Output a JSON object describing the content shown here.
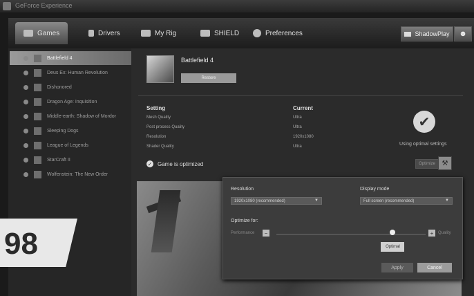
{
  "window": {
    "title": "GeForce Experience"
  },
  "nav": {
    "tabs": [
      {
        "label": "Games",
        "icon": "gamepad-icon"
      },
      {
        "label": "Drivers",
        "icon": "download-icon"
      },
      {
        "label": "My Rig",
        "icon": "monitor-icon"
      },
      {
        "label": "SHIELD",
        "icon": "shield-device-icon"
      },
      {
        "label": "Preferences",
        "icon": "gears-icon"
      }
    ],
    "sharing_label": "ShadowPlay",
    "user_icon": "user-icon"
  },
  "sidebar": {
    "items": [
      {
        "label": "Battlefield 4",
        "selected": true
      },
      {
        "label": "Deus Ex: Human Revolution"
      },
      {
        "label": "Dishonored"
      },
      {
        "label": "Dragon Age: Inquisition"
      },
      {
        "label": "Middle-earth: Shadow of Mordor"
      },
      {
        "label": "Sleeping Dogs"
      },
      {
        "label": "League of Legends"
      },
      {
        "label": "StarCraft II"
      },
      {
        "label": "Wolfenstein: The New Order"
      }
    ]
  },
  "game": {
    "title": "Battlefield 4",
    "subtitle": "",
    "restore_label": "Restore"
  },
  "settings_table": {
    "headers": {
      "setting": "Setting",
      "current": "Current"
    },
    "rows": [
      {
        "setting": "Mesh Quality",
        "current": "Ultra"
      },
      {
        "setting": "Post process Quality",
        "current": "Ultra"
      },
      {
        "setting": "Resolution",
        "current": "1920x1080"
      },
      {
        "setting": "Shader Quality",
        "current": "Ultra"
      }
    ]
  },
  "status": {
    "text": "Game is optimized"
  },
  "optimal": {
    "text": "Using optimal settings",
    "optimize_label": "Optimize"
  },
  "panel": {
    "resolution_label": "Resolution",
    "resolution_value": "1920x1080 (recommended)",
    "display_mode_label": "Display mode",
    "display_mode_value": "Full screen (recommended)",
    "optimize_for_label": "Optimize for:",
    "left_label": "Performance",
    "right_label": "Quality",
    "thumb_label": "Optimal",
    "apply_label": "Apply",
    "cancel_label": "Cancel",
    "slider_level": 0.78
  },
  "badge": {
    "number": "98"
  }
}
